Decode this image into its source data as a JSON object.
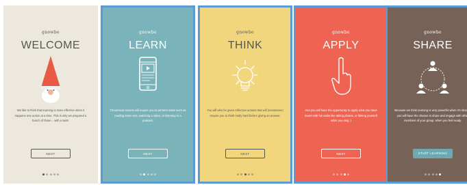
{
  "screens": [
    {
      "brand": "gnowbe",
      "title": "WELCOME",
      "icon": "gnome-icon",
      "body": "We like to think that learning is more effective when it happens one action at a time. This is why we prepared a bunch of those... with a twist.",
      "button": "NEXT",
      "bg": "#ede8de",
      "fg": "#555555",
      "active_dot": 1
    },
    {
      "brand": "gnowbe",
      "title": "LEARN",
      "icon": "phone-icon",
      "body": "Theoretical actions will require you to perform tasks such as reading some text, watching a video, or listening to a podcast.",
      "button": "NEXT",
      "bg": "#7ab3ba",
      "fg": "#ffffff",
      "active_dot": 2
    },
    {
      "brand": "gnowbe",
      "title": "THINK",
      "icon": "lightbulb-icon",
      "body": "You will also be given reflective actions that will (sometimes) require you to think really hard before giving an answer.",
      "button": "NEXT",
      "bg": "#f2d67e",
      "fg": "#555555",
      "active_dot": 3
    },
    {
      "brand": "gnowbe",
      "title": "APPLY",
      "icon": "pointing-hand-icon",
      "body": "And you will have the opportunity to apply what you have learnt with fun tasks like taking photos, or filming yourself while you sing :)",
      "button": "NEXT",
      "bg": "#ee6352",
      "fg": "#ffffff",
      "active_dot": 4
    },
    {
      "brand": "gnowbe",
      "title": "SHARE",
      "icon": "share-people-icon",
      "body": "Because we think learning is very powerful when it's shared, you will have the chance to share and engage with other members of your group, when you feel ready.",
      "button": "START LEARNING",
      "bg": "#776257",
      "fg": "#ffffff",
      "active_dot": 5
    }
  ],
  "selected_screens": [
    2,
    3,
    4,
    5
  ],
  "accent": "#5b9bd5",
  "share_button_bg": "#6ea9b0"
}
